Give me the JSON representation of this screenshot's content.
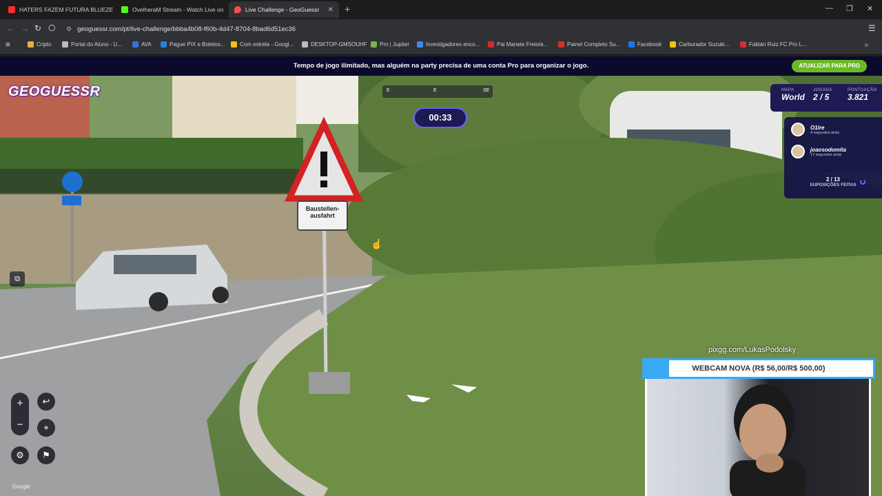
{
  "browser": {
    "tabs": [
      {
        "title": "HATERS FAZEM FUTURA BLUEZETE",
        "color": "#ff2a2a"
      },
      {
        "title": "OvelheraM Stream - Watch Live on",
        "color": "#53fc18"
      },
      {
        "title": "Live Challenge - GeoGuessr",
        "color": "#ff4d4d",
        "active": true
      }
    ],
    "new_tab": "+",
    "window_controls": [
      "—",
      "❐",
      "✕"
    ],
    "url": "geoguessr.com/pt/live-challenge/bbba4b08-f60b-4d47-8704-8bad6d51ec36",
    "bookmarks": [
      {
        "label": "Cripto",
        "color": "#e3b341"
      },
      {
        "label": "Portal do Aluno - U...",
        "color": "#bbbbbb"
      },
      {
        "label": "AVA",
        "color": "#3b6fd8"
      },
      {
        "label": "Pague PIX e Boletos...",
        "color": "#2a7de1"
      },
      {
        "label": "Com estrela - Googl...",
        "color": "#f4c20d"
      },
      {
        "label": "DESKTOP-GMSOUHF",
        "color": "#bbbbbb"
      },
      {
        "label": "Pro | Jupiter",
        "color": "#77b255"
      },
      {
        "label": "Investigadores enco...",
        "color": "#4285f4"
      },
      {
        "label": "Pai Manete Freio/e...",
        "color": "#d32f2f"
      },
      {
        "label": "Painel Completo Su...",
        "color": "#d32f2f"
      },
      {
        "label": "Facebook",
        "color": "#1877f2"
      },
      {
        "label": "Carburador Suzuki...",
        "color": "#f4c20d"
      },
      {
        "label": "Fabián Ruiz FC Pro L...",
        "color": "#d32f2f"
      }
    ],
    "bookmarks_more": "»"
  },
  "banner": {
    "text": "Tempo de jogo ilimitado, mas alguém na party precisa de uma conta Pro para organizar o jogo.",
    "button": "ATUALIZAR PARA PRO"
  },
  "game": {
    "logo": "GEOGUESSR",
    "compass": [
      "E",
      "E",
      "SE"
    ],
    "timer": "00:33",
    "map_label": "MAPA",
    "map_value": "World",
    "round_label": "JOGADA",
    "round_value": "2 / 5",
    "score_label": "PONTUAÇÃO",
    "score_value": "3.821",
    "players": [
      {
        "name": "O1ire",
        "time": "4 segundos atrás"
      },
      {
        "name": "joaosodomita",
        "time": "17 segundos atrás"
      }
    ],
    "guess_count": "2 / 13",
    "guess_label": "SUPOSIÇÕES FEITAS",
    "sign_text": [
      "Baustellen-",
      "ausfahrt"
    ],
    "google": "Google"
  },
  "overlay": {
    "pix": "pixgg.com/LukasPodolsky",
    "webcam": "WEBCAM NOVA (R$ 56,00/R$ 500,00)"
  }
}
